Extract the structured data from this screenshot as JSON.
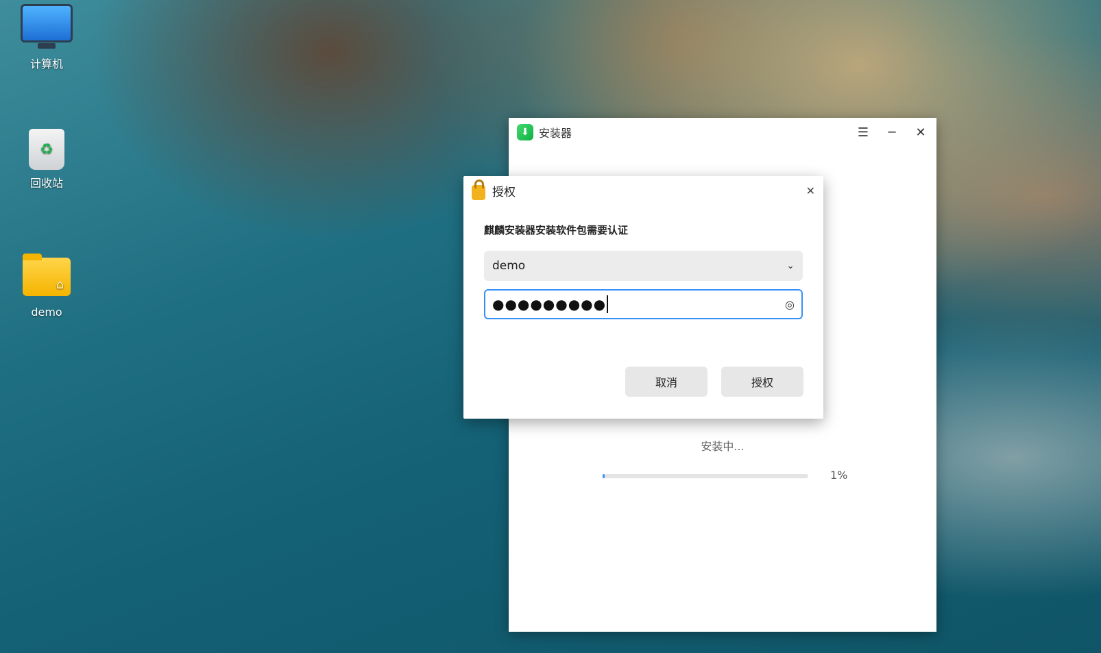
{
  "desktop": {
    "icons": [
      {
        "label": "计算机"
      },
      {
        "label": "回收站"
      },
      {
        "label": "demo"
      }
    ]
  },
  "installer": {
    "title": "安装器",
    "status": "安装中...",
    "progress_percent": 1,
    "progress_label": "1%",
    "menu_glyph": "☰",
    "minimize_glyph": "─",
    "close_glyph": "✕"
  },
  "auth_dialog": {
    "title": "授权",
    "message": "麒麟安装器安装软件包需要认证",
    "username": "demo",
    "password_mask": "●●●●●●●●●",
    "cancel_label": "取消",
    "authorize_label": "授权",
    "close_glyph": "✕",
    "dropdown_glyph": "⌄",
    "eye_glyph": "◎"
  },
  "colors": {
    "accent": "#3790fa",
    "logo_green": "#10b043",
    "lock_gold": "#f2b21d"
  }
}
